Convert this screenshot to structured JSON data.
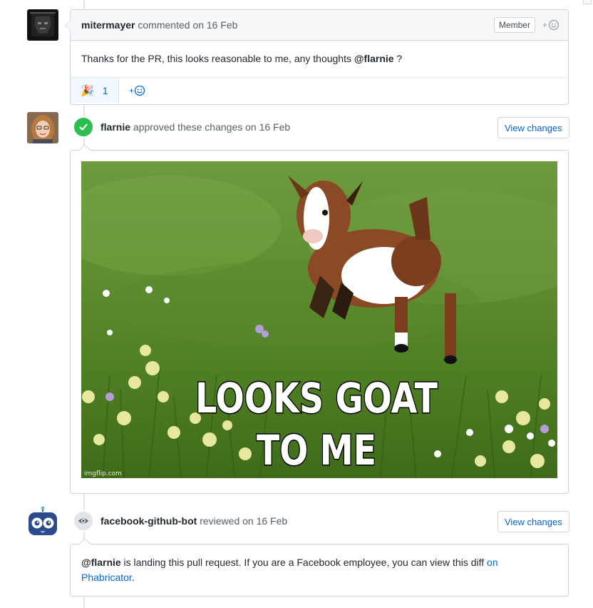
{
  "comment1": {
    "author": "mitermayer",
    "action": " commented on 16 Feb",
    "badge": "Member",
    "add_reaction": "+",
    "body": "Thanks for the PR, this looks reasonable to me, any thoughts ",
    "mention": "@flarnie",
    "body_end": " ?",
    "reaction_emoji": "🎉",
    "reaction_count": "1",
    "add_reaction_bottom": "+"
  },
  "review1": {
    "author": "flarnie",
    "action": " approved these changes on 16 Feb",
    "view_button": "View changes",
    "image_caption_line1": "LOOKS GOAT",
    "image_caption_line2": "TO ME",
    "image_watermark": "imgflip.com"
  },
  "review2": {
    "author": "facebook-github-bot",
    "action": " reviewed on 16 Feb",
    "view_button": "View changes",
    "mention": "@flarnie",
    "body": " is landing this pull request. If you are a Facebook employee, you can view this diff ",
    "link1": "on",
    "link2": "Phabricator",
    "body_end": "."
  },
  "colors": {
    "link": "#0366d6",
    "approved_green": "#2cbe4e",
    "border": "#d1d5da",
    "header_bg": "#f6f8fa"
  },
  "icons": {
    "approved": "check-icon",
    "reviewed": "eye-icon",
    "reaction": "smiley-icon"
  }
}
